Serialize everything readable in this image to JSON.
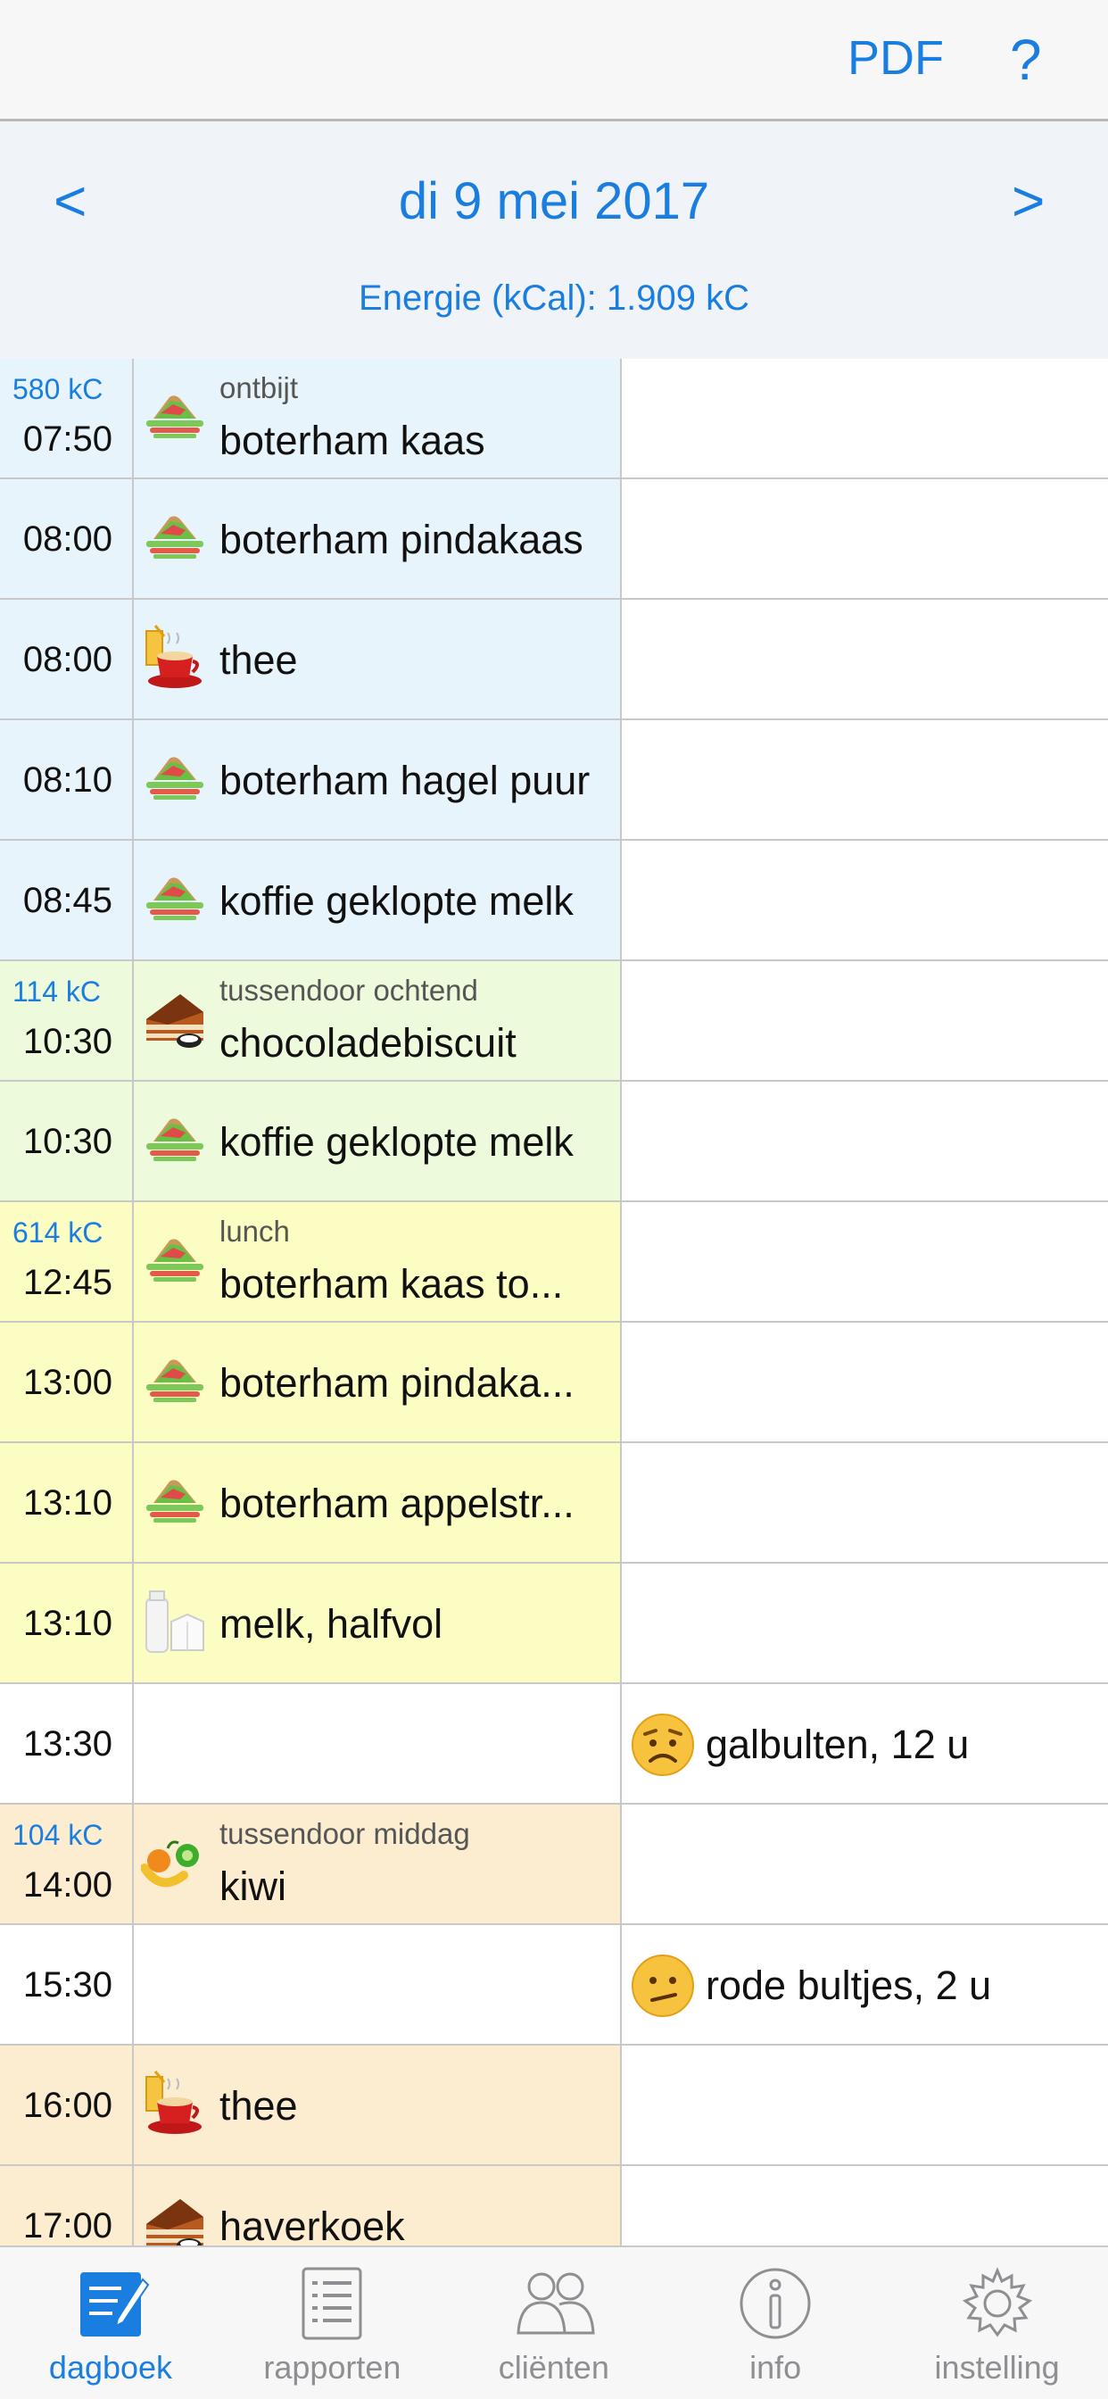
{
  "header": {
    "pdf_label": "PDF",
    "help_label": "?"
  },
  "day_nav": {
    "prev_label": "<",
    "next_label": ">",
    "date": "di 9 mei 2017",
    "energy": "Energie (kCal): 1.909 kC"
  },
  "colors": {
    "accent": "#1a7de0",
    "ontbijt": "#e8f4fb",
    "tussendoor_ochtend": "#eefadc",
    "lunch": "#fcfdc2",
    "tussendoor_middag": "#fcecd0",
    "plain": "#ffffff"
  },
  "rows": [
    {
      "kc": "580 kC",
      "time": "07:50",
      "meal_type": "ontbijt",
      "food": "boterham kaas",
      "icon": "sandwich-icon",
      "bg": "#e8f4fb"
    },
    {
      "time": "08:00",
      "food": "boterham pindakaas",
      "icon": "sandwich-icon",
      "bg": "#e8f4fb"
    },
    {
      "time": "08:00",
      "food": "thee",
      "icon": "drink-icon",
      "bg": "#e8f4fb"
    },
    {
      "time": "08:10",
      "food": "boterham hagel puur",
      "icon": "sandwich-icon",
      "bg": "#e8f4fb"
    },
    {
      "time": "08:45",
      "food": "koffie geklopte melk",
      "icon": "sandwich-icon",
      "bg": "#e8f4fb"
    },
    {
      "kc": "114 kC",
      "time": "10:30",
      "meal_type": "tussendoor ochtend",
      "food": "chocoladebiscuit",
      "icon": "cake-icon",
      "bg": "#eefadc"
    },
    {
      "time": "10:30",
      "food": "koffie geklopte melk",
      "icon": "sandwich-icon",
      "bg": "#eefadc"
    },
    {
      "kc": "614 kC",
      "time": "12:45",
      "meal_type": "lunch",
      "food": "boterham kaas to...",
      "icon": "sandwich-icon",
      "bg": "#fcfdc2"
    },
    {
      "time": "13:00",
      "food": "boterham pindaka...",
      "icon": "sandwich-icon",
      "bg": "#fcfdc2"
    },
    {
      "time": "13:10",
      "food": "boterham appelstr...",
      "icon": "sandwich-icon",
      "bg": "#fcfdc2"
    },
    {
      "time": "13:10",
      "food": "melk, halfvol",
      "icon": "milk-icon",
      "bg": "#fcfdc2"
    },
    {
      "time": "13:30",
      "symptom": "galbulten, 12 u",
      "symptom_icon": "worried-face-icon",
      "bg": "#ffffff"
    },
    {
      "kc": "104 kC",
      "time": "14:00",
      "meal_type": "tussendoor middag",
      "food": "kiwi",
      "icon": "fruit-icon",
      "bg": "#fcecd0"
    },
    {
      "time": "15:30",
      "symptom": "rode bultjes, 2 u",
      "symptom_icon": "confused-face-icon",
      "bg": "#ffffff"
    },
    {
      "time": "16:00",
      "food": "thee",
      "icon": "drink-icon",
      "bg": "#fcecd0"
    },
    {
      "time": "17:00",
      "food": "haverkoek",
      "icon": "cake-icon",
      "bg": "#fcecd0"
    }
  ],
  "tabs": [
    {
      "label": "dagboek",
      "icon": "diary-icon",
      "active": true
    },
    {
      "label": "rapporten",
      "icon": "report-icon",
      "active": false
    },
    {
      "label": "cliënten",
      "icon": "clients-icon",
      "active": false
    },
    {
      "label": "info",
      "icon": "info-icon",
      "active": false
    },
    {
      "label": "instelling",
      "icon": "settings-icon",
      "active": false
    }
  ]
}
